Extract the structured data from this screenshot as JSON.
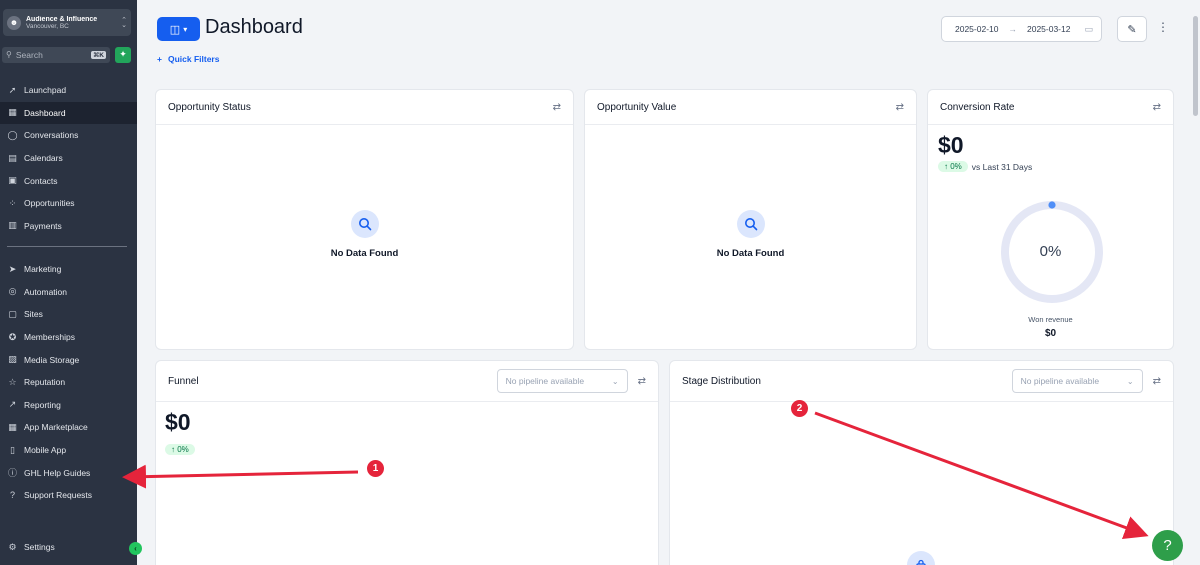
{
  "account": {
    "name": "Audience & Influence",
    "location": "Vancouver, BC"
  },
  "search": {
    "placeholder": "Search",
    "shortcut": "⌘K"
  },
  "nav_top": [
    {
      "id": "launchpad",
      "label": "Launchpad",
      "icon": "rocket-icon"
    },
    {
      "id": "dashboard",
      "label": "Dashboard",
      "icon": "grid-icon",
      "active": true
    },
    {
      "id": "conversations",
      "label": "Conversations",
      "icon": "chat-icon"
    },
    {
      "id": "calendars",
      "label": "Calendars",
      "icon": "calendar-icon"
    },
    {
      "id": "contacts",
      "label": "Contacts",
      "icon": "contacts-icon"
    },
    {
      "id": "opportunities",
      "label": "Opportunities",
      "icon": "opportunities-icon"
    },
    {
      "id": "payments",
      "label": "Payments",
      "icon": "payments-icon"
    }
  ],
  "nav_bottom": [
    {
      "id": "marketing",
      "label": "Marketing",
      "icon": "send-icon"
    },
    {
      "id": "automation",
      "label": "Automation",
      "icon": "automation-icon"
    },
    {
      "id": "sites",
      "label": "Sites",
      "icon": "sites-icon"
    },
    {
      "id": "memberships",
      "label": "Memberships",
      "icon": "award-icon"
    },
    {
      "id": "media-storage",
      "label": "Media Storage",
      "icon": "image-icon"
    },
    {
      "id": "reputation",
      "label": "Reputation",
      "icon": "star-icon"
    },
    {
      "id": "reporting",
      "label": "Reporting",
      "icon": "trend-icon"
    },
    {
      "id": "app-marketplace",
      "label": "App Marketplace",
      "icon": "apps-icon"
    },
    {
      "id": "mobile-app",
      "label": "Mobile App",
      "icon": "mobile-icon"
    },
    {
      "id": "ghl-help-guides",
      "label": "GHL Help Guides",
      "icon": "info-icon"
    },
    {
      "id": "support-requests",
      "label": "Support Requests",
      "icon": "help-circle-icon"
    }
  ],
  "settings_label": "Settings",
  "header": {
    "title": "Dashboard",
    "quick_filters": "Quick Filters",
    "date_start": "2025-02-10",
    "date_end": "2025-03-12"
  },
  "cards": {
    "opportunity_status": {
      "title": "Opportunity Status",
      "empty": "No Data Found"
    },
    "opportunity_value": {
      "title": "Opportunity Value",
      "empty": "No Data Found"
    },
    "conversion_rate": {
      "title": "Conversion Rate",
      "value": "$0",
      "change": "0%",
      "compare": "vs Last 31 Days",
      "ring_percent": "0%",
      "won_label": "Won revenue",
      "won_value": "$0"
    },
    "funnel": {
      "title": "Funnel",
      "pipeline_placeholder": "No pipeline available",
      "value": "$0",
      "change": "0%"
    },
    "stage_distribution": {
      "title": "Stage Distribution",
      "pipeline_placeholder": "No pipeline available"
    }
  },
  "annotations": {
    "one": "1",
    "two": "2"
  },
  "help_fab": "?",
  "colors": {
    "sidebar_bg": "#2b3342",
    "accent": "#155eef",
    "annotation": "#e5243b",
    "help_fab": "#2e9e4a"
  }
}
